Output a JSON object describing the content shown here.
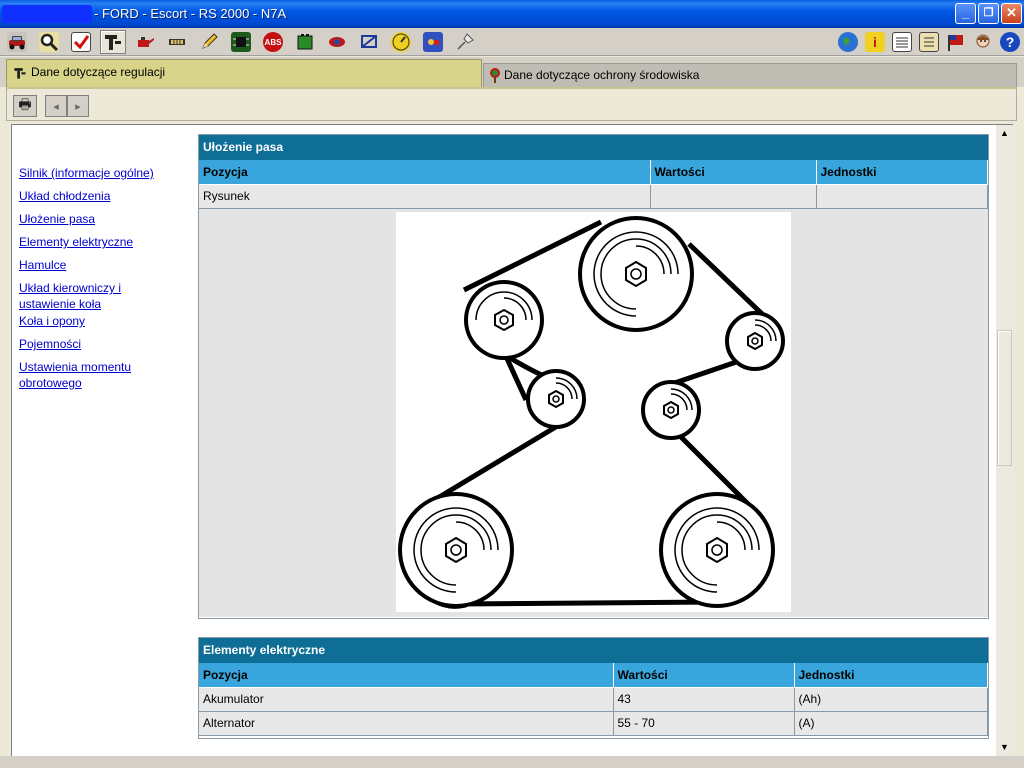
{
  "window": {
    "title": "- FORD - Escort - RS 2000 - N7A",
    "min_label": "_",
    "max_label": "❐",
    "close_label": "✕"
  },
  "toolbar": {
    "left_icons": [
      "car-icon",
      "inspect-magnifier-icon",
      "checkbox-tick-icon",
      "adjustment-data-icon",
      "oil-can-icon",
      "gauge-strip-icon",
      "pencil-icon",
      "circuit-board-icon",
      "abs-icon",
      "battery-icon",
      "tyre-lift-icon",
      "frame-icon",
      "dial-icon",
      "engine-camera-icon",
      "pin-icon"
    ],
    "abs_label": "ABS",
    "right_icons": [
      "globe-icon",
      "info-icon",
      "document-icon",
      "notebook-icon",
      "flag-icon",
      "avatar-icon",
      "help-icon"
    ],
    "help_label": "?"
  },
  "tabs": [
    {
      "label": "Dane dotyczące regulacji",
      "active": true
    },
    {
      "label": "Dane dotyczące ochrony środowiska",
      "active": false
    }
  ],
  "nav": {
    "print_label": "🖶",
    "back_label": "◂",
    "forward_label": "▸"
  },
  "left_links": [
    "Silnik (informacje ogólne)",
    "Układ chłodzenia",
    "Ułożenie pasa",
    "Elementy elektryczne",
    "Hamulce",
    "Układ kierowniczy i ustawienie koła",
    "Koła i opony",
    "Pojemności",
    "Ustawienia momentu obrotowego"
  ],
  "belt_section": {
    "title": "Ułożenie pasa",
    "headers": [
      "Pozycja",
      "Wartości",
      "Jednostki"
    ],
    "rows": [
      [
        "Rysunek",
        "",
        ""
      ]
    ]
  },
  "electric_section": {
    "title": "Elementy elektryczne",
    "headers": [
      "Pozycja",
      "Wartości",
      "Jednostki"
    ],
    "rows": [
      [
        "Akumulator",
        "43",
        "(Ah)"
      ],
      [
        "Alternator",
        "55 - 70",
        "(A)"
      ]
    ]
  },
  "colors": {
    "section_title_bg": "#0e6e96",
    "table_header_bg": "#38a6dc",
    "active_tab_bg": "#d8d48a",
    "titlebar_blue": "#0058e6"
  }
}
